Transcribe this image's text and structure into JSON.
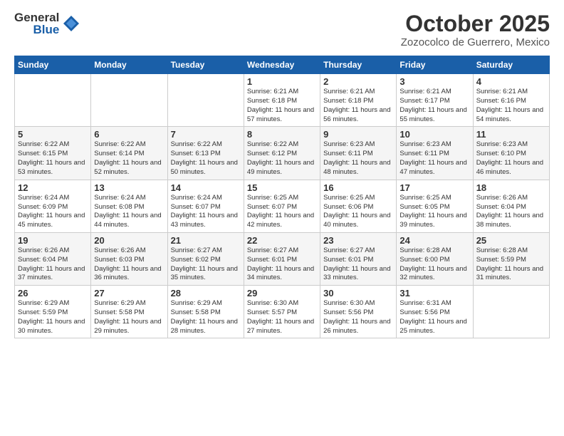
{
  "logo": {
    "general": "General",
    "blue": "Blue"
  },
  "title": "October 2025",
  "subtitle": "Zozocolco de Guerrero, Mexico",
  "days": [
    "Sunday",
    "Monday",
    "Tuesday",
    "Wednesday",
    "Thursday",
    "Friday",
    "Saturday"
  ],
  "weeks": [
    [
      {
        "day": "",
        "sunrise": "",
        "sunset": "",
        "daylight": ""
      },
      {
        "day": "",
        "sunrise": "",
        "sunset": "",
        "daylight": ""
      },
      {
        "day": "",
        "sunrise": "",
        "sunset": "",
        "daylight": ""
      },
      {
        "day": "1",
        "sunrise": "Sunrise: 6:21 AM",
        "sunset": "Sunset: 6:18 PM",
        "daylight": "Daylight: 11 hours and 57 minutes."
      },
      {
        "day": "2",
        "sunrise": "Sunrise: 6:21 AM",
        "sunset": "Sunset: 6:18 PM",
        "daylight": "Daylight: 11 hours and 56 minutes."
      },
      {
        "day": "3",
        "sunrise": "Sunrise: 6:21 AM",
        "sunset": "Sunset: 6:17 PM",
        "daylight": "Daylight: 11 hours and 55 minutes."
      },
      {
        "day": "4",
        "sunrise": "Sunrise: 6:21 AM",
        "sunset": "Sunset: 6:16 PM",
        "daylight": "Daylight: 11 hours and 54 minutes."
      }
    ],
    [
      {
        "day": "5",
        "sunrise": "Sunrise: 6:22 AM",
        "sunset": "Sunset: 6:15 PM",
        "daylight": "Daylight: 11 hours and 53 minutes."
      },
      {
        "day": "6",
        "sunrise": "Sunrise: 6:22 AM",
        "sunset": "Sunset: 6:14 PM",
        "daylight": "Daylight: 11 hours and 52 minutes."
      },
      {
        "day": "7",
        "sunrise": "Sunrise: 6:22 AM",
        "sunset": "Sunset: 6:13 PM",
        "daylight": "Daylight: 11 hours and 50 minutes."
      },
      {
        "day": "8",
        "sunrise": "Sunrise: 6:22 AM",
        "sunset": "Sunset: 6:12 PM",
        "daylight": "Daylight: 11 hours and 49 minutes."
      },
      {
        "day": "9",
        "sunrise": "Sunrise: 6:23 AM",
        "sunset": "Sunset: 6:11 PM",
        "daylight": "Daylight: 11 hours and 48 minutes."
      },
      {
        "day": "10",
        "sunrise": "Sunrise: 6:23 AM",
        "sunset": "Sunset: 6:11 PM",
        "daylight": "Daylight: 11 hours and 47 minutes."
      },
      {
        "day": "11",
        "sunrise": "Sunrise: 6:23 AM",
        "sunset": "Sunset: 6:10 PM",
        "daylight": "Daylight: 11 hours and 46 minutes."
      }
    ],
    [
      {
        "day": "12",
        "sunrise": "Sunrise: 6:24 AM",
        "sunset": "Sunset: 6:09 PM",
        "daylight": "Daylight: 11 hours and 45 minutes."
      },
      {
        "day": "13",
        "sunrise": "Sunrise: 6:24 AM",
        "sunset": "Sunset: 6:08 PM",
        "daylight": "Daylight: 11 hours and 44 minutes."
      },
      {
        "day": "14",
        "sunrise": "Sunrise: 6:24 AM",
        "sunset": "Sunset: 6:07 PM",
        "daylight": "Daylight: 11 hours and 43 minutes."
      },
      {
        "day": "15",
        "sunrise": "Sunrise: 6:25 AM",
        "sunset": "Sunset: 6:07 PM",
        "daylight": "Daylight: 11 hours and 42 minutes."
      },
      {
        "day": "16",
        "sunrise": "Sunrise: 6:25 AM",
        "sunset": "Sunset: 6:06 PM",
        "daylight": "Daylight: 11 hours and 40 minutes."
      },
      {
        "day": "17",
        "sunrise": "Sunrise: 6:25 AM",
        "sunset": "Sunset: 6:05 PM",
        "daylight": "Daylight: 11 hours and 39 minutes."
      },
      {
        "day": "18",
        "sunrise": "Sunrise: 6:26 AM",
        "sunset": "Sunset: 6:04 PM",
        "daylight": "Daylight: 11 hours and 38 minutes."
      }
    ],
    [
      {
        "day": "19",
        "sunrise": "Sunrise: 6:26 AM",
        "sunset": "Sunset: 6:04 PM",
        "daylight": "Daylight: 11 hours and 37 minutes."
      },
      {
        "day": "20",
        "sunrise": "Sunrise: 6:26 AM",
        "sunset": "Sunset: 6:03 PM",
        "daylight": "Daylight: 11 hours and 36 minutes."
      },
      {
        "day": "21",
        "sunrise": "Sunrise: 6:27 AM",
        "sunset": "Sunset: 6:02 PM",
        "daylight": "Daylight: 11 hours and 35 minutes."
      },
      {
        "day": "22",
        "sunrise": "Sunrise: 6:27 AM",
        "sunset": "Sunset: 6:01 PM",
        "daylight": "Daylight: 11 hours and 34 minutes."
      },
      {
        "day": "23",
        "sunrise": "Sunrise: 6:27 AM",
        "sunset": "Sunset: 6:01 PM",
        "daylight": "Daylight: 11 hours and 33 minutes."
      },
      {
        "day": "24",
        "sunrise": "Sunrise: 6:28 AM",
        "sunset": "Sunset: 6:00 PM",
        "daylight": "Daylight: 11 hours and 32 minutes."
      },
      {
        "day": "25",
        "sunrise": "Sunrise: 6:28 AM",
        "sunset": "Sunset: 5:59 PM",
        "daylight": "Daylight: 11 hours and 31 minutes."
      }
    ],
    [
      {
        "day": "26",
        "sunrise": "Sunrise: 6:29 AM",
        "sunset": "Sunset: 5:59 PM",
        "daylight": "Daylight: 11 hours and 30 minutes."
      },
      {
        "day": "27",
        "sunrise": "Sunrise: 6:29 AM",
        "sunset": "Sunset: 5:58 PM",
        "daylight": "Daylight: 11 hours and 29 minutes."
      },
      {
        "day": "28",
        "sunrise": "Sunrise: 6:29 AM",
        "sunset": "Sunset: 5:58 PM",
        "daylight": "Daylight: 11 hours and 28 minutes."
      },
      {
        "day": "29",
        "sunrise": "Sunrise: 6:30 AM",
        "sunset": "Sunset: 5:57 PM",
        "daylight": "Daylight: 11 hours and 27 minutes."
      },
      {
        "day": "30",
        "sunrise": "Sunrise: 6:30 AM",
        "sunset": "Sunset: 5:56 PM",
        "daylight": "Daylight: 11 hours and 26 minutes."
      },
      {
        "day": "31",
        "sunrise": "Sunrise: 6:31 AM",
        "sunset": "Sunset: 5:56 PM",
        "daylight": "Daylight: 11 hours and 25 minutes."
      },
      {
        "day": "",
        "sunrise": "",
        "sunset": "",
        "daylight": ""
      }
    ]
  ]
}
